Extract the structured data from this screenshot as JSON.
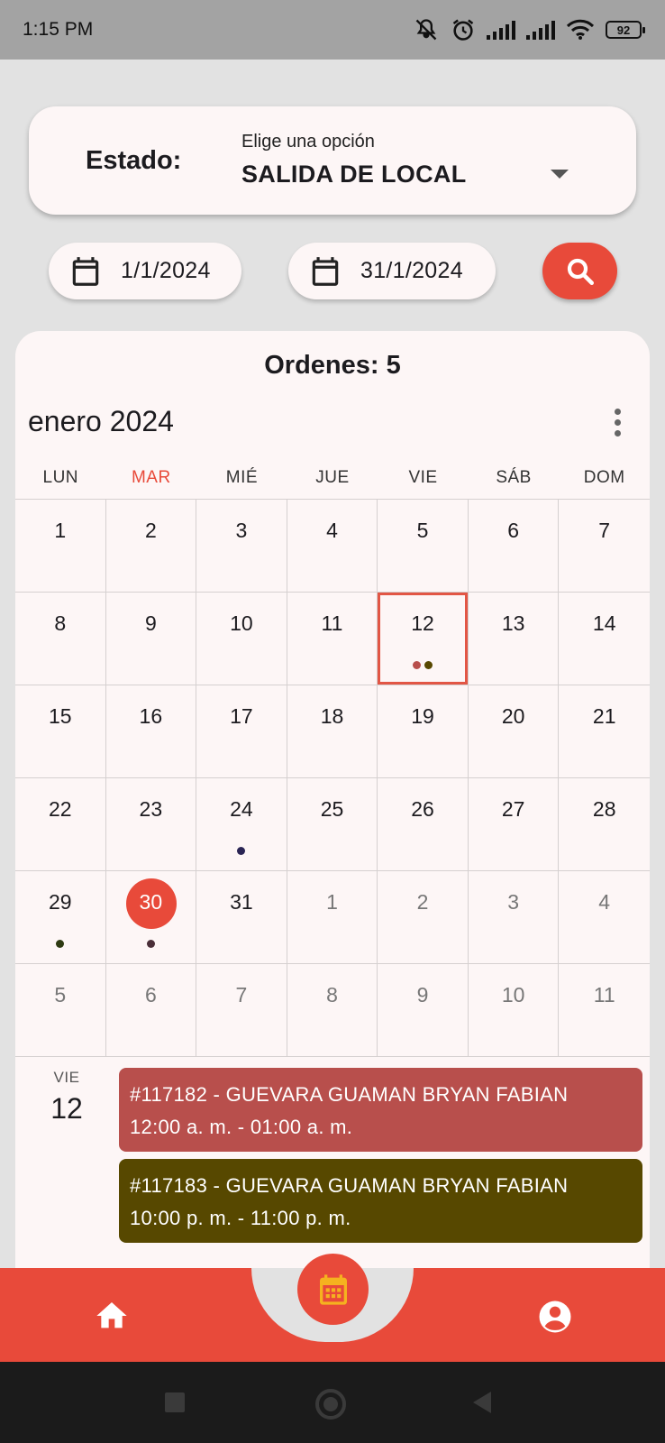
{
  "status_bar": {
    "time": "1:15 PM",
    "battery": "92"
  },
  "estado": {
    "label": "Estado:",
    "hint": "Elige una opción",
    "value": "SALIDA DE LOCAL"
  },
  "date_range": {
    "start": "1/1/2024",
    "end": "31/1/2024"
  },
  "orders_title": "Ordenes: 5",
  "calendar": {
    "month": "enero 2024",
    "weekdays": [
      "LUN",
      "MAR",
      "MIÉ",
      "JUE",
      "VIE",
      "SÁB",
      "DOM"
    ],
    "today_weekday": "MAR",
    "weeks": [
      [
        {
          "d": "1"
        },
        {
          "d": "2"
        },
        {
          "d": "3"
        },
        {
          "d": "4"
        },
        {
          "d": "5"
        },
        {
          "d": "6"
        },
        {
          "d": "7"
        }
      ],
      [
        {
          "d": "8"
        },
        {
          "d": "9"
        },
        {
          "d": "10"
        },
        {
          "d": "11"
        },
        {
          "d": "12",
          "selected": true,
          "dots": [
            "#b84f4c",
            "#574800"
          ]
        },
        {
          "d": "13"
        },
        {
          "d": "14"
        }
      ],
      [
        {
          "d": "15"
        },
        {
          "d": "16"
        },
        {
          "d": "17"
        },
        {
          "d": "18"
        },
        {
          "d": "19"
        },
        {
          "d": "20"
        },
        {
          "d": "21"
        }
      ],
      [
        {
          "d": "22"
        },
        {
          "d": "23"
        },
        {
          "d": "24",
          "dots": [
            "#2a2454"
          ]
        },
        {
          "d": "25"
        },
        {
          "d": "26"
        },
        {
          "d": "27"
        },
        {
          "d": "28"
        }
      ],
      [
        {
          "d": "29",
          "dots": [
            "#2e3a12"
          ]
        },
        {
          "d": "30",
          "today": true,
          "dots": [
            "#4a2e38"
          ]
        },
        {
          "d": "31"
        },
        {
          "d": "1",
          "other": true
        },
        {
          "d": "2",
          "other": true
        },
        {
          "d": "3",
          "other": true
        },
        {
          "d": "4",
          "other": true
        }
      ],
      [
        {
          "d": "5",
          "other": true
        },
        {
          "d": "6",
          "other": true
        },
        {
          "d": "7",
          "other": true
        },
        {
          "d": "8",
          "other": true
        },
        {
          "d": "9",
          "other": true
        },
        {
          "d": "10",
          "other": true
        },
        {
          "d": "11",
          "other": true
        }
      ]
    ]
  },
  "agenda": {
    "weekday": "VIE",
    "day": "12",
    "appointments": [
      {
        "title": "#117182 - GUEVARA GUAMAN BRYAN FABIAN",
        "time": "12:00 a. m. - 01:00 a. m.",
        "color": "#b84f4c"
      },
      {
        "title": "#117183 - GUEVARA GUAMAN BRYAN FABIAN",
        "time": "10:00 p. m. - 11:00 p. m.",
        "color": "#574800"
      }
    ]
  },
  "colors": {
    "accent": "#e84a3a",
    "fab_icon": "#f5b21f"
  },
  "icons": {
    "status": [
      "mute-icon",
      "alarm-icon",
      "signal-icon",
      "signal-icon",
      "wifi-icon",
      "battery-icon"
    ],
    "date_field": "calendar-icon",
    "search_button": "search-icon",
    "nav": [
      "home-icon",
      "calendar-grid-icon",
      "account-circle-icon"
    ]
  }
}
